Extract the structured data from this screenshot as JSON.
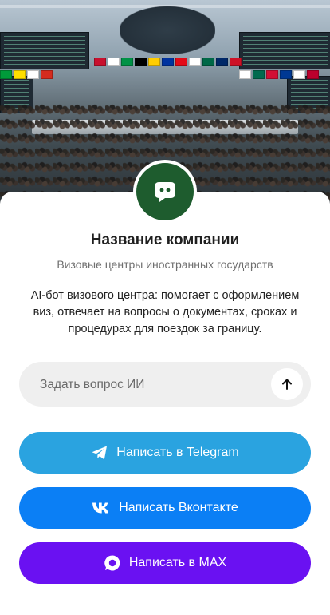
{
  "company": {
    "name": "Название компании",
    "subtitle": "Визовые центры иностранных государств",
    "description": "AI-бот визового центра: помогает с оформлением виз, отвечает на вопросы о документах, сроках и процедурах для поездок за границу."
  },
  "ask": {
    "placeholder": "Задать вопрос ИИ",
    "value": ""
  },
  "buttons": {
    "telegram": {
      "label": "Написать в Telegram",
      "color": "#2aa3e0",
      "icon": "telegram-icon"
    },
    "vk": {
      "label": "Написать Вконтакте",
      "color": "#0b7ff5",
      "icon": "vk-icon"
    },
    "max": {
      "label": "Написать в MAX",
      "color": "#6a11f2",
      "icon": "max-icon"
    }
  },
  "colors": {
    "avatar_bg": "#1e5c2e",
    "ask_bg": "#efefef"
  }
}
